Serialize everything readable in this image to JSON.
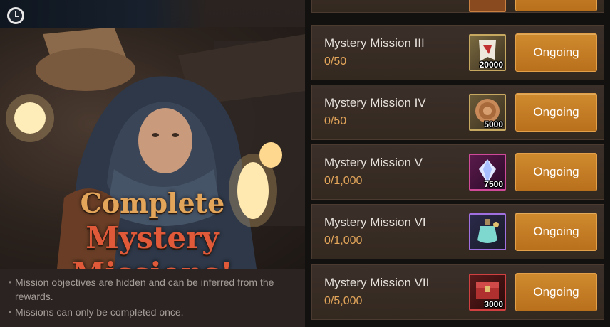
{
  "banner": {
    "headline_line1": "Complete",
    "headline_line2": "Mystery Missions!"
  },
  "notes": [
    "Mission objectives are hidden and can be inferred from the rewards.",
    "Missions can only be completed once."
  ],
  "missions": [
    {
      "title": "Mystery Mission III",
      "progress": "0/50",
      "reward_qty": "20000",
      "reward_icon": "scroll-icon",
      "button": "Ongoing"
    },
    {
      "title": "Mystery Mission IV",
      "progress": "0/50",
      "reward_qty": "5000",
      "reward_icon": "coin-icon",
      "button": "Ongoing"
    },
    {
      "title": "Mystery Mission V",
      "progress": "0/1,000",
      "reward_qty": "7500",
      "reward_icon": "crystal-icon",
      "button": "Ongoing"
    },
    {
      "title": "Mystery Mission VI",
      "progress": "0/1,000",
      "reward_qty": "",
      "reward_icon": "potion-icon",
      "button": "Ongoing"
    },
    {
      "title": "Mystery Mission VII",
      "progress": "0/5,000",
      "reward_qty": "3000",
      "reward_icon": "chest-icon",
      "button": "Ongoing"
    }
  ],
  "colors": {
    "accent_orange": "#cf8a2e",
    "headline_gold": "#e3a55a",
    "headline_red": "#e05a3a"
  }
}
